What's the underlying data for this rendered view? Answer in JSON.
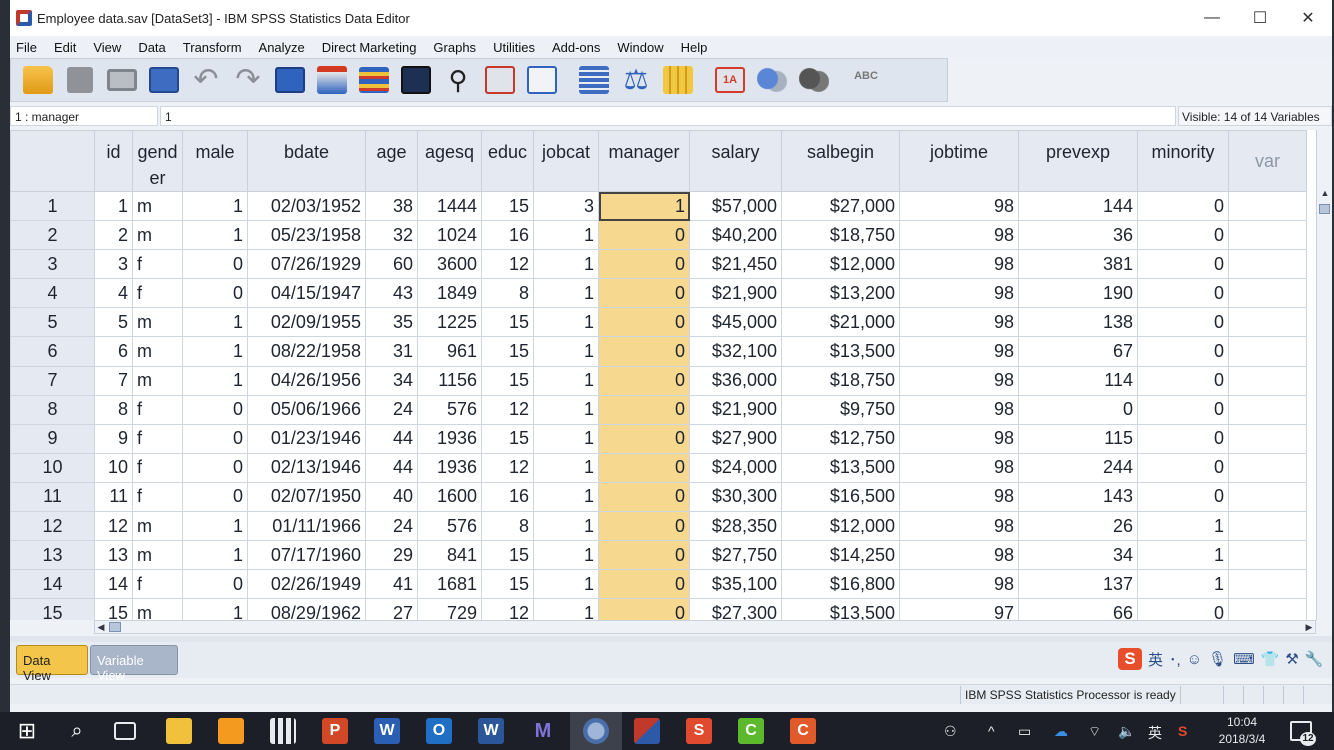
{
  "window": {
    "title": "Employee data.sav [DataSet3] - IBM SPSS Statistics Data Editor",
    "minimize": "—",
    "maximize": "☐",
    "close": "✕"
  },
  "menu": [
    "File",
    "Edit",
    "View",
    "Data",
    "Transform",
    "Analyze",
    "Direct Marketing",
    "Graphs",
    "Utilities",
    "Add-ons",
    "Window",
    "Help"
  ],
  "toolbar": {
    "icons": [
      "open-folder-icon",
      "save-icon",
      "print-icon",
      "dialog-recall-icon",
      "undo-icon",
      "redo-icon",
      "goto-case-icon",
      "goto-variable-icon",
      "variables-icon",
      "run-descriptive-icon",
      "find-icon",
      "insert-cases-icon",
      "insert-variable-icon",
      "split-file-icon",
      "weight-cases-icon",
      "select-cases-icon",
      "value-labels-icon",
      "use-variable-sets-icon",
      "show-all-variables-icon",
      "spell-check-icon"
    ],
    "spell_label": "ABC",
    "undo_glyph": "↶",
    "redo_glyph": "↷",
    "find_glyph": "⚲",
    "weight_glyph": "⚖",
    "value_labels_glyph": "1A"
  },
  "cellbar": {
    "cell_ref": "1 : manager",
    "cell_value": "1",
    "visible": "Visible: 14 of 14 Variables"
  },
  "grid": {
    "columns": [
      "id",
      "gend er",
      "male",
      "bdate",
      "age",
      "agesq",
      "educ",
      "jobcat",
      "manager",
      "salary",
      "salbegin",
      "jobtime",
      "prevexp",
      "minority",
      "var"
    ],
    "rows": [
      [
        "1",
        "1",
        "m",
        "1",
        "02/03/1952",
        "38",
        "1444",
        "15",
        "3",
        "1",
        "$57,000",
        "$27,000",
        "98",
        "144",
        "0"
      ],
      [
        "2",
        "2",
        "m",
        "1",
        "05/23/1958",
        "32",
        "1024",
        "16",
        "1",
        "0",
        "$40,200",
        "$18,750",
        "98",
        "36",
        "0"
      ],
      [
        "3",
        "3",
        "f",
        "0",
        "07/26/1929",
        "60",
        "3600",
        "12",
        "1",
        "0",
        "$21,450",
        "$12,000",
        "98",
        "381",
        "0"
      ],
      [
        "4",
        "4",
        "f",
        "0",
        "04/15/1947",
        "43",
        "1849",
        "8",
        "1",
        "0",
        "$21,900",
        "$13,200",
        "98",
        "190",
        "0"
      ],
      [
        "5",
        "5",
        "m",
        "1",
        "02/09/1955",
        "35",
        "1225",
        "15",
        "1",
        "0",
        "$45,000",
        "$21,000",
        "98",
        "138",
        "0"
      ],
      [
        "6",
        "6",
        "m",
        "1",
        "08/22/1958",
        "31",
        "961",
        "15",
        "1",
        "0",
        "$32,100",
        "$13,500",
        "98",
        "67",
        "0"
      ],
      [
        "7",
        "7",
        "m",
        "1",
        "04/26/1956",
        "34",
        "1156",
        "15",
        "1",
        "0",
        "$36,000",
        "$18,750",
        "98",
        "114",
        "0"
      ],
      [
        "8",
        "8",
        "f",
        "0",
        "05/06/1966",
        "24",
        "576",
        "12",
        "1",
        "0",
        "$21,900",
        "$9,750",
        "98",
        "0",
        "0"
      ],
      [
        "9",
        "9",
        "f",
        "0",
        "01/23/1946",
        "44",
        "1936",
        "15",
        "1",
        "0",
        "$27,900",
        "$12,750",
        "98",
        "115",
        "0"
      ],
      [
        "10",
        "10",
        "f",
        "0",
        "02/13/1946",
        "44",
        "1936",
        "12",
        "1",
        "0",
        "$24,000",
        "$13,500",
        "98",
        "244",
        "0"
      ],
      [
        "11",
        "11",
        "f",
        "0",
        "02/07/1950",
        "40",
        "1600",
        "16",
        "1",
        "0",
        "$30,300",
        "$16,500",
        "98",
        "143",
        "0"
      ],
      [
        "12",
        "12",
        "m",
        "1",
        "01/11/1966",
        "24",
        "576",
        "8",
        "1",
        "0",
        "$28,350",
        "$12,000",
        "98",
        "26",
        "1"
      ],
      [
        "13",
        "13",
        "m",
        "1",
        "07/17/1960",
        "29",
        "841",
        "15",
        "1",
        "0",
        "$27,750",
        "$14,250",
        "98",
        "34",
        "1"
      ],
      [
        "14",
        "14",
        "f",
        "0",
        "02/26/1949",
        "41",
        "1681",
        "15",
        "1",
        "0",
        "$35,100",
        "$16,800",
        "98",
        "137",
        "1"
      ],
      [
        "15",
        "15",
        "m",
        "1",
        "08/29/1962",
        "27",
        "729",
        "12",
        "1",
        "0",
        "$27,300",
        "$13,500",
        "97",
        "66",
        "0"
      ]
    ],
    "selected_column": "manager",
    "active_cell": {
      "row": 1,
      "column": "manager"
    }
  },
  "tabs": {
    "data_view": "Data View",
    "variable_view": "Variable View"
  },
  "ime": {
    "logo": "S",
    "lang": "英",
    "symbols": "･,",
    "smile": "☺",
    "mic": "🎙",
    "kbd": "⌨",
    "shirt": "👕",
    "tools": "⚒",
    "wrench": "🔧"
  },
  "status": {
    "processor": "IBM SPSS Statistics Processor is ready"
  },
  "taskbar": {
    "time": "10:04",
    "date": "2018/3/4",
    "ime_lang": "英",
    "notifications": "12",
    "up_glyph": "^",
    "person_glyph": "⚇",
    "speaker_glyph": "🔈",
    "wifi_glyph": "⌔",
    "battery_glyph": "▭",
    "onedrive_glyph": "☁",
    "s_logo": "S",
    "search_glyph": "⌕",
    "start_glyph": "⊞",
    "ppt_letter": "P",
    "word_letter": "W",
    "outlook_letter": "O",
    "mplus_letter": "M",
    "c_letter": "C"
  },
  "colors": {
    "selected_column": "#f6d98e",
    "active_tab": "#f3c54a",
    "header_bg": "#e4e9f2"
  }
}
